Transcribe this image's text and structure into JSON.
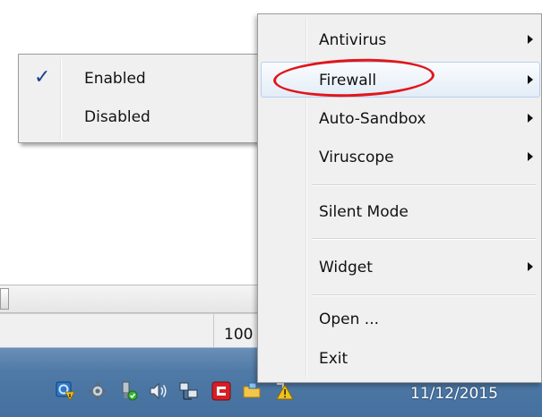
{
  "context_menu": {
    "items": [
      {
        "label": "Antivirus",
        "has_submenu": true
      },
      {
        "label": "Firewall",
        "has_submenu": true,
        "highlighted": true
      },
      {
        "label": "Auto-Sandbox",
        "has_submenu": true
      },
      {
        "label": "Viruscope",
        "has_submenu": true
      },
      {
        "label": "Silent Mode",
        "has_submenu": false
      },
      {
        "label": "Widget",
        "has_submenu": true
      },
      {
        "label": "Open ...",
        "has_submenu": false
      },
      {
        "label": "Exit",
        "has_submenu": false
      }
    ]
  },
  "firewall_submenu": {
    "items": [
      {
        "label": "Enabled",
        "checked": true
      },
      {
        "label": "Disabled",
        "checked": false
      }
    ]
  },
  "status_bar": {
    "zoom": "100"
  },
  "taskbar": {
    "clock": "11/12/2015",
    "tray_icons": [
      "network-warning-icon",
      "settings-gear-icon",
      "usb-device-icon",
      "volume-icon",
      "network-icon",
      "comodo-security-icon",
      "folder-icon",
      "action-center-warning-icon"
    ]
  },
  "colors": {
    "taskbar": "#4f79a6",
    "menu_background": "#f0f0f0",
    "annotation_ring": "#e0161b",
    "check_mark": "#1c3f8c"
  }
}
